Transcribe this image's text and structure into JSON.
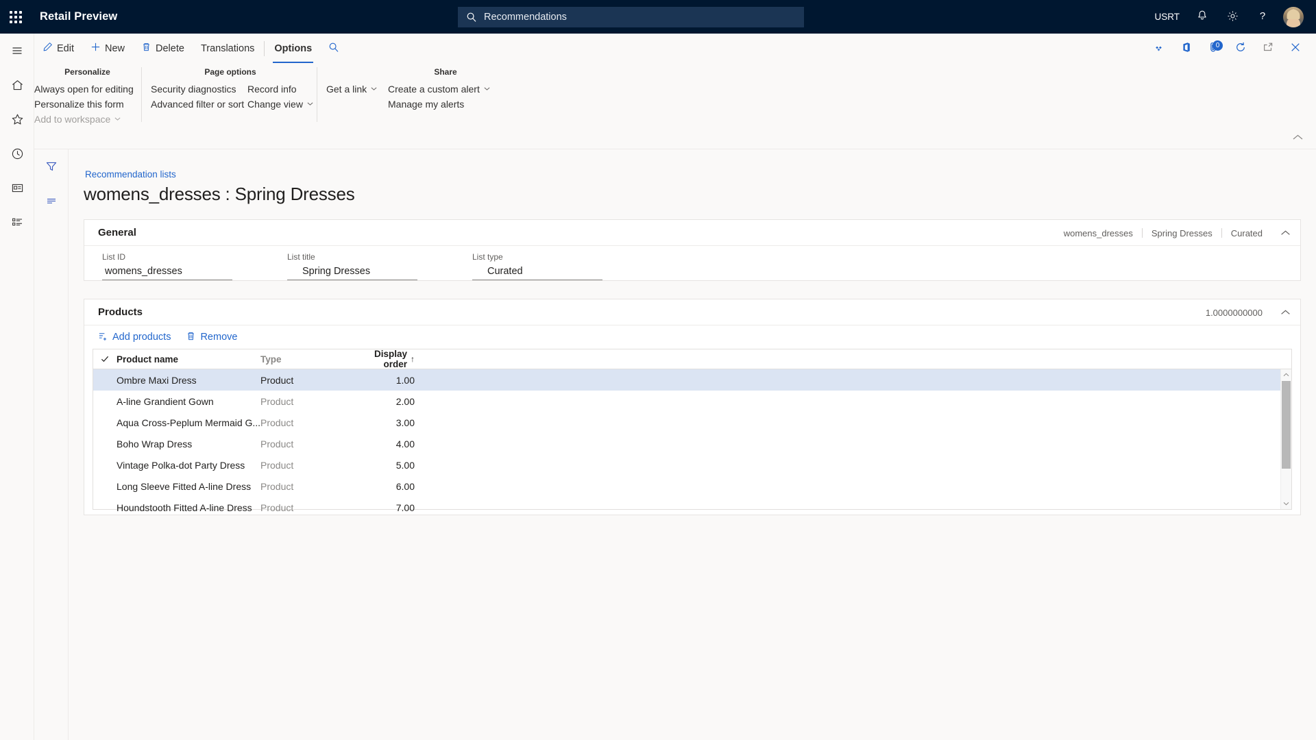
{
  "topnav": {
    "waffle_label": "app-launcher",
    "app_title": "Retail Preview",
    "search": {
      "value": "Recommendations",
      "icon": "search-icon"
    },
    "company": "USRT",
    "icons": [
      "bell-icon",
      "gear-icon",
      "question-icon"
    ],
    "avatar_label": "user-avatar"
  },
  "ribbon": {
    "tabs": [
      {
        "label": "Edit",
        "icon": "pencil-icon",
        "selected": false
      },
      {
        "label": "New",
        "icon": "plus-icon",
        "selected": false
      },
      {
        "label": "Delete",
        "icon": "trash-icon",
        "selected": false
      },
      {
        "label": "Translations",
        "icon": "",
        "selected": false
      },
      {
        "label": "Options",
        "icon": "",
        "selected": true
      }
    ],
    "search_icon": "search-icon",
    "right_icons": [
      {
        "name": "power-apps-icon",
        "badge": ""
      },
      {
        "name": "office-icon",
        "badge": ""
      },
      {
        "name": "attachments-icon",
        "badge": "0"
      },
      {
        "name": "refresh-icon",
        "badge": ""
      },
      {
        "name": "open-in-new-window-icon",
        "badge": ""
      },
      {
        "name": "close-icon",
        "badge": ""
      }
    ],
    "groups": [
      {
        "title": "Personalize",
        "commands": [
          {
            "label": "Always open for editing",
            "chevron": false,
            "disabled": false
          },
          {
            "label": "Personalize this form",
            "chevron": false,
            "disabled": false
          },
          {
            "label": "Add to workspace",
            "chevron": true,
            "disabled": true
          }
        ]
      },
      {
        "title": "Page options",
        "commands_col1": [
          {
            "label": "Security diagnostics",
            "chevron": false,
            "disabled": false
          },
          {
            "label": "Advanced filter or sort",
            "chevron": false,
            "disabled": false
          }
        ],
        "commands_col2": [
          {
            "label": "Record info",
            "chevron": false,
            "disabled": false
          },
          {
            "label": "Change view",
            "chevron": true,
            "disabled": false
          }
        ],
        "commands_col3": [
          {
            "label": "Get a link",
            "chevron": true,
            "disabled": false
          }
        ]
      },
      {
        "title": "Share",
        "commands": [
          {
            "label": "Create a custom alert",
            "chevron": true,
            "disabled": false
          },
          {
            "label": "Manage my alerts",
            "chevron": false,
            "disabled": false
          }
        ]
      }
    ],
    "collapse_icon": "chevron-up-icon"
  },
  "rail": {
    "items": [
      {
        "name": "hamburger-menu-icon"
      },
      {
        "name": "home-icon"
      },
      {
        "name": "favorites-star-icon"
      },
      {
        "name": "recent-clock-icon"
      },
      {
        "name": "workspaces-icon"
      },
      {
        "name": "modules-list-icon"
      }
    ]
  },
  "toolcol": {
    "items": [
      {
        "name": "filter-icon"
      },
      {
        "name": "attachments-lines-icon"
      }
    ]
  },
  "page": {
    "breadcrumb": "Recommendation lists",
    "title": "womens_dresses : Spring Dresses"
  },
  "general": {
    "title": "General",
    "summary": [
      "womens_dresses",
      "Spring Dresses",
      "Curated"
    ],
    "fields": [
      {
        "label": "List ID",
        "value": "womens_dresses",
        "placeholder": ""
      },
      {
        "label": "List title",
        "value": "Spring Dresses",
        "placeholder": ""
      },
      {
        "label": "List type",
        "value": "Curated",
        "placeholder": ""
      }
    ]
  },
  "products": {
    "title": "Products",
    "summary": "1.0000000000",
    "toolbar": [
      {
        "label": "Add products",
        "icon": "add-product-icon"
      },
      {
        "label": "Remove",
        "icon": "trash-icon"
      }
    ],
    "columns": [
      {
        "label": "Product name",
        "sort": ""
      },
      {
        "label": "Type",
        "sort": ""
      },
      {
        "label": "Display order",
        "sort": "↑"
      }
    ],
    "rows": [
      {
        "name": "Ombre Maxi Dress",
        "type": "Product",
        "order": "1.00",
        "selected": true
      },
      {
        "name": "A-line Grandient Gown",
        "type": "Product",
        "order": "2.00",
        "selected": false
      },
      {
        "name": "Aqua Cross-Peplum Mermaid G...",
        "type": "Product",
        "order": "3.00",
        "selected": false
      },
      {
        "name": "Boho Wrap Dress",
        "type": "Product",
        "order": "4.00",
        "selected": false
      },
      {
        "name": "Vintage Polka-dot Party  Dress",
        "type": "Product",
        "order": "5.00",
        "selected": false
      },
      {
        "name": "Long Sleeve Fitted A-line Dress",
        "type": "Product",
        "order": "6.00",
        "selected": false
      },
      {
        "name": "Houndstooth Fitted A-line Dress",
        "type": "Product",
        "order": "7.00",
        "selected": false
      }
    ]
  },
  "colors": {
    "nav_bg": "#001730",
    "accent": "#2266cc",
    "selected_row": "#dbe4f3",
    "page_bg": "#faf9f8"
  }
}
